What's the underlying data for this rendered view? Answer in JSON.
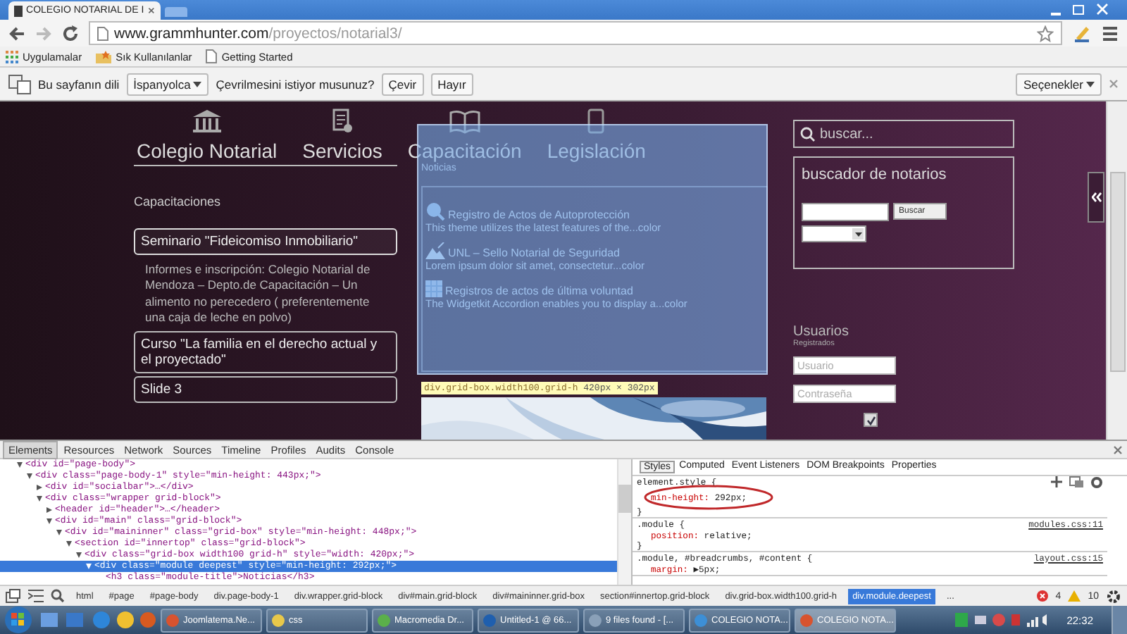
{
  "browser": {
    "tab_title": "COLEGIO NOTARIAL DE I",
    "url_host": "www.grammhunter.com",
    "url_path": "/proyectos/notarial3/",
    "bookmarks": [
      {
        "label": "Uygulamalar",
        "kind": "apps"
      },
      {
        "label": "Sık Kullanılanlar",
        "kind": "star-folder"
      },
      {
        "label": "Getting Started",
        "kind": "page"
      }
    ]
  },
  "translate_bar": {
    "prompt": "Bu sayfanın dili",
    "language": "İspanyolca",
    "question": "Çevrilmesini istiyor musunuz?",
    "buttons": [
      "Çevir",
      "Hayır"
    ],
    "options": "Seçenekler"
  },
  "site": {
    "nav": [
      {
        "label": "Colegio Notarial",
        "kind": "building"
      },
      {
        "label": "Servicios",
        "kind": "document"
      },
      {
        "label": "Capacitación",
        "kind": "book"
      },
      {
        "label": "Legislación",
        "kind": "phone"
      }
    ],
    "sidebar_title": "Capacitaciones",
    "slides": [
      {
        "title": "Seminario \"Fideicomiso Inmobiliario\"",
        "expanded": true,
        "detail": "Informes e inscripción: Colegio Notarial de Mendoza – Depto.de Capacitación – Un alimento no perecedero ( preferentemente una caja de leche en polvo)"
      },
      {
        "title": "Curso \"La familia en el derecho actual y el proyectado\"",
        "expanded": false
      },
      {
        "title": "Slide 3",
        "expanded": false
      }
    ],
    "module_title": "Noticias",
    "news": [
      {
        "title": "Registro de Actos de Autoprotección",
        "text": "This theme utilizes the latest features of the...color",
        "kind": "magnifier"
      },
      {
        "title": "UNL – Sello Notarial de Seguridad",
        "text": "Lorem ipsum dolor sit amet, consectetur...color",
        "kind": "mountain"
      },
      {
        "title": "Registros de actos de última voluntad",
        "text": "The Widgetkit Accordion enables you to display a...color",
        "kind": "grid"
      }
    ],
    "highlight_tooltip": {
      "selector": "div.grid-box.width100.grid-h",
      "size": "420px × 302px"
    },
    "search": {
      "placeholder": "buscar..."
    },
    "finder": {
      "title": "buscador de notarios",
      "button": "Buscar"
    },
    "login": {
      "title": "Usuarios",
      "subtitle": "Registrados",
      "user_placeholder": "Usuario",
      "password_placeholder": "Contraseña",
      "remember": true
    }
  },
  "devtools": {
    "tabs": [
      {
        "label": "Elements",
        "selected": true
      },
      {
        "label": "Resources",
        "selected": false
      },
      {
        "label": "Network",
        "selected": false
      },
      {
        "label": "Sources",
        "selected": false
      },
      {
        "label": "Timeline",
        "selected": false
      },
      {
        "label": "Profiles",
        "selected": false
      },
      {
        "label": "Audits",
        "selected": false
      },
      {
        "label": "Console",
        "selected": false
      }
    ],
    "dom": [
      {
        "text": "<div id=\"page-body\">",
        "expanded": true,
        "selected": false,
        "children": [
          {
            "text": "<div class=\"page-body-1\" style=\"min-height: 443px;\">",
            "expanded": true,
            "selected": false,
            "children": [
              {
                "text": "<div id=\"socialbar\">…</div>",
                "expanded": false,
                "selected": false
              },
              {
                "text": "<div class=\"wrapper grid-block\">",
                "expanded": true,
                "selected": false,
                "children": [
                  {
                    "text": "<header id=\"header\">…</header>",
                    "expanded": false,
                    "selected": false
                  },
                  {
                    "text": "<div id=\"main\" class=\"grid-block\">",
                    "expanded": true,
                    "selected": false,
                    "children": [
                      {
                        "text": "<div id=\"maininner\" class=\"grid-box\" style=\"min-height: 448px;\">",
                        "expanded": true,
                        "selected": false,
                        "children": [
                          {
                            "text": "<section id=\"innertop\" class=\"grid-block\">",
                            "expanded": true,
                            "selected": false,
                            "children": [
                              {
                                "text": "<div class=\"grid-box width100 grid-h\" style=\"width: 420px;\">",
                                "expanded": true,
                                "selected": false,
                                "children": [
                                  {
                                    "text": "<div class=\"module   deepest\" style=\"min-height: 292px;\">",
                                    "expanded": true,
                                    "selected": true,
                                    "children": [
                                      {
                                        "text": "<h3 class=\"module-title\">Noticias</h3>",
                                        "selected": false
                                      }
                                    ]
                                  }
                                ]
                              }
                            ]
                          }
                        ]
                      }
                    ]
                  }
                ]
              }
            ]
          }
        ]
      }
    ],
    "style_tabs": [
      {
        "label": "Styles",
        "selected": true
      },
      {
        "label": "Computed",
        "selected": false
      },
      {
        "label": "Event Listeners",
        "selected": false
      },
      {
        "label": "DOM Breakpoints",
        "selected": false
      },
      {
        "label": "Properties",
        "selected": false
      }
    ],
    "rules": [
      {
        "open": "element.style {",
        "declarations": [
          {
            "property": "min-height:",
            "value": "292px;"
          }
        ],
        "close": "}",
        "circled": true
      },
      {
        "open": ".module {",
        "source": "modules.css:11",
        "declarations": [
          {
            "property": "position:",
            "value": "relative;"
          }
        ],
        "close": "}"
      },
      {
        "open": ".module, #breadcrumbs, #content {",
        "source": "layout.css:15",
        "declarations": [
          {
            "property": "margin:",
            "value": "▶5px;"
          }
        ]
      }
    ],
    "breadcrumbs": [
      {
        "label": "html",
        "selected": false
      },
      {
        "label": "#page",
        "selected": false
      },
      {
        "label": "#page-body",
        "selected": false
      },
      {
        "label": "div.page-body-1",
        "selected": false
      },
      {
        "label": "div.wrapper.grid-block",
        "selected": false
      },
      {
        "label": "div#main.grid-block",
        "selected": false
      },
      {
        "label": "div#maininner.grid-box",
        "selected": false
      },
      {
        "label": "section#innertop.grid-block",
        "selected": false
      },
      {
        "label": "div.grid-box.width100.grid-h",
        "selected": false
      },
      {
        "label": "div.module.deepest",
        "selected": true
      }
    ],
    "more": "...",
    "errors": "4",
    "warnings": "10"
  },
  "taskbar": {
    "tasks": [
      {
        "label": "Joomlatema.Ne...",
        "kind": "browser",
        "selected": false
      },
      {
        "label": "css",
        "kind": "folder",
        "selected": false
      },
      {
        "label": "Macromedia Dr...",
        "kind": "editor",
        "selected": false
      },
      {
        "label": "Untitled-1 @ 66...",
        "selected": false
      },
      {
        "label": "9 files found - [...",
        "kind": "search",
        "selected": false
      },
      {
        "label": "COLEGIO NOTA...",
        "kind": "ie",
        "selected": false
      },
      {
        "label": "COLEGIO NOTA...",
        "kind": "browser",
        "selected": true
      }
    ],
    "time": "22:32"
  }
}
